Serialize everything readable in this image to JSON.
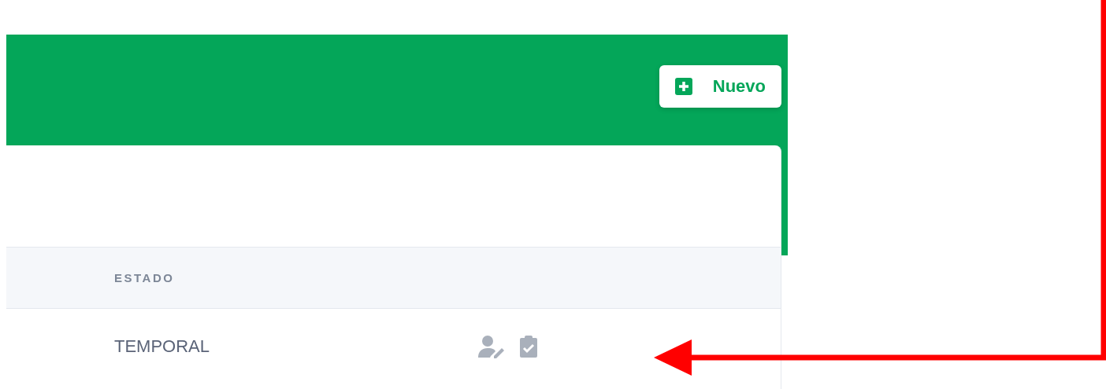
{
  "header": {
    "new_button": {
      "label": "Nuevo"
    }
  },
  "table": {
    "columns": [
      {
        "label": "ESTADO"
      }
    ],
    "rows": [
      {
        "estado": "TEMPORAL",
        "actions": [
          {
            "kind": "assign"
          },
          {
            "kind": "approve"
          }
        ]
      }
    ]
  }
}
